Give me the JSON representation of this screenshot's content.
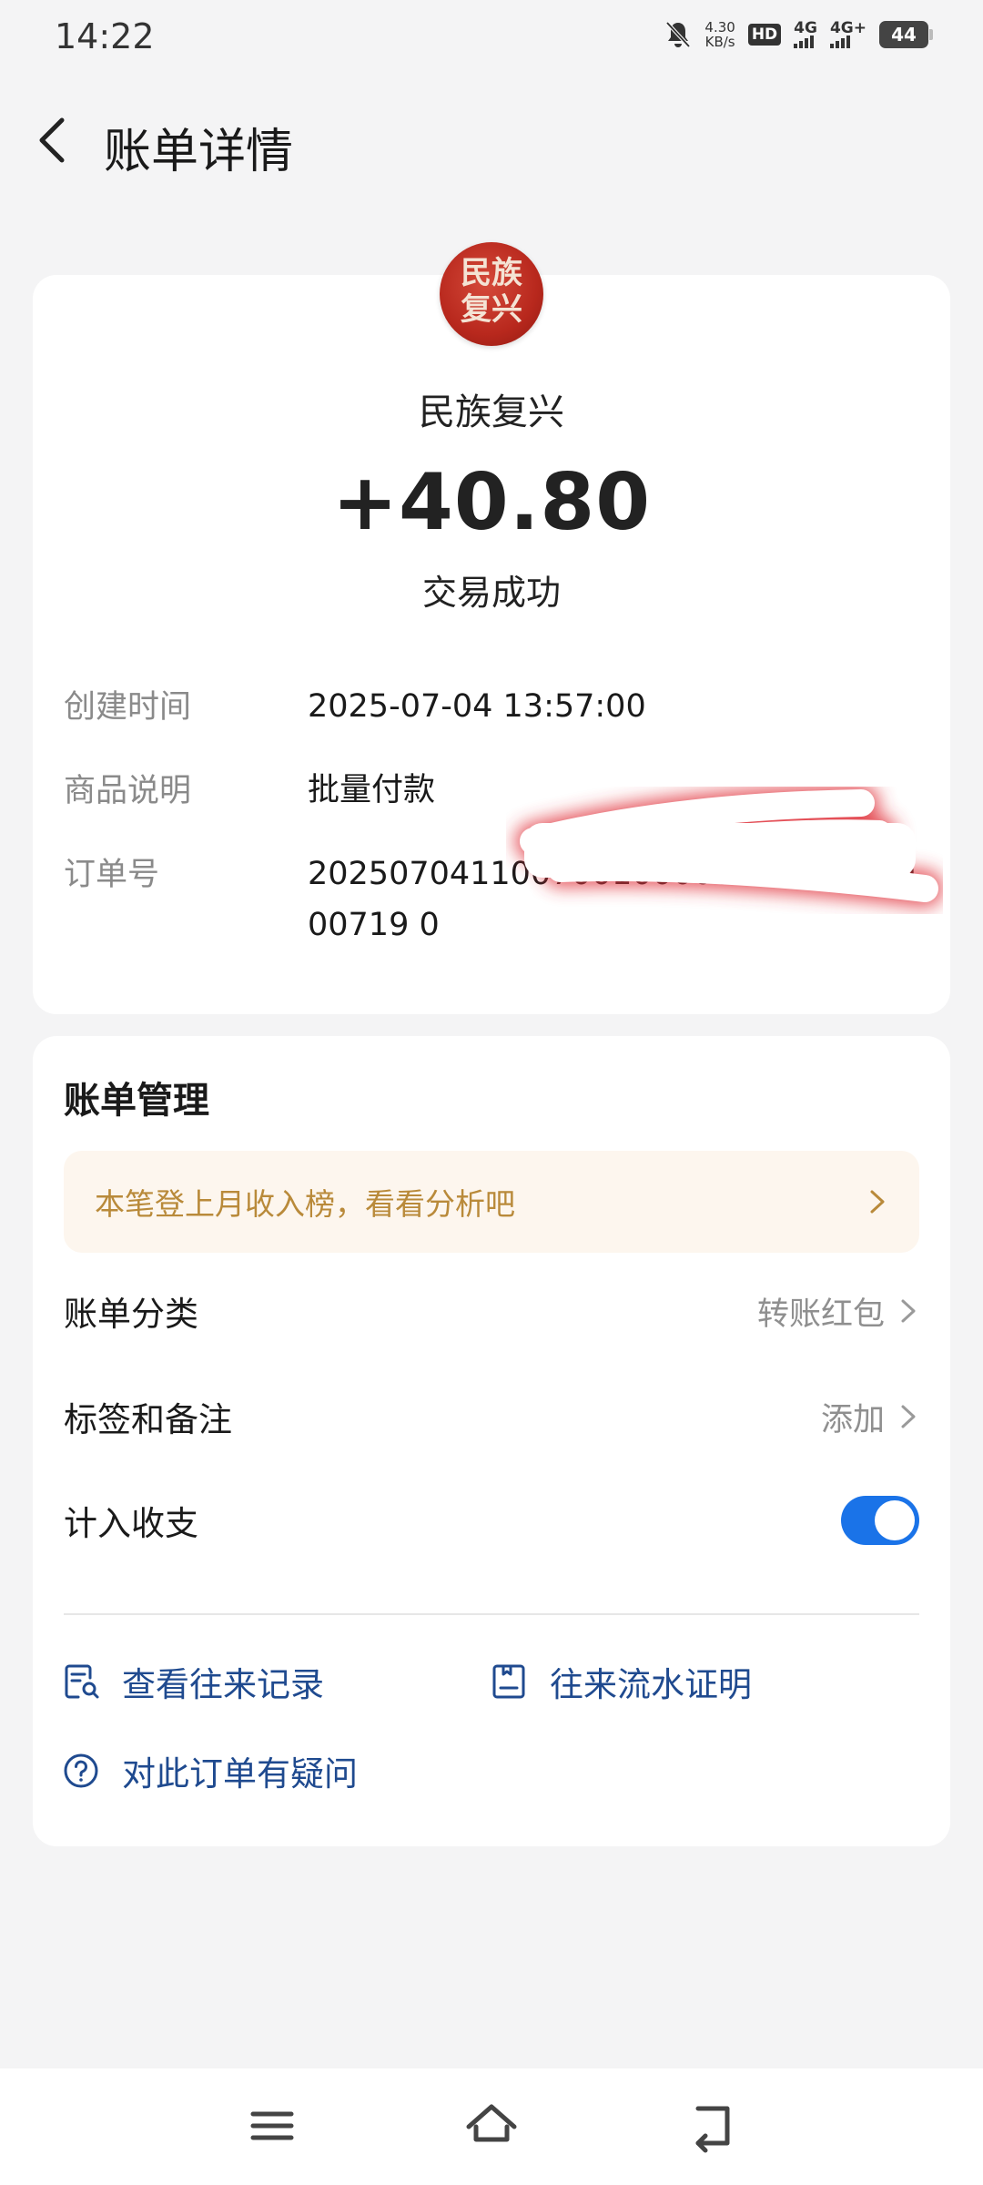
{
  "status_bar": {
    "time": "14:22",
    "speed": "4.30",
    "speed_unit": "KB/s",
    "hd_label": "HD",
    "sim1_label": "4G",
    "sim2_label": "4G+",
    "battery": "44"
  },
  "header": {
    "title": "账单详情",
    "back_icon": "chevron-left-icon"
  },
  "summary": {
    "logo_text_line1": "民族",
    "logo_text_line2": "复兴",
    "merchant": "民族复兴",
    "amount": "+40.80",
    "status": "交易成功",
    "details": {
      "time_label": "创建时间",
      "time_value": "2025-07-04 13:57:00",
      "desc_label": "商品说明",
      "desc_value": "批量付款",
      "order_label": "订单号",
      "order_value": "20250704110070010000000000000000719 0"
    }
  },
  "manage": {
    "title": "账单管理",
    "banner": "本笔登上月收入榜，看看分析吧",
    "category_label": "账单分类",
    "category_value": "转账红包",
    "tag_label": "标签和备注",
    "tag_value": "添加",
    "count_label": "计入收支",
    "count_enabled": true,
    "links": {
      "records": "查看往来记录",
      "proof": "往来流水证明",
      "question": "对此订单有疑问"
    }
  },
  "colors": {
    "accent": "#1a73e8",
    "link": "#1f4a8f",
    "banner_bg": "#fdf6ee",
    "banner_text": "#b98a3a",
    "logo_red": "#b8281d"
  }
}
